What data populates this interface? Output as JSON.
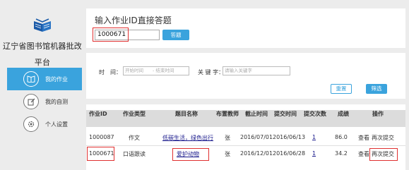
{
  "brand": {
    "line1": "辽宁省图书馆机器批改",
    "line2": "平台"
  },
  "nav": [
    {
      "label": "我的作业",
      "icon": "book-icon",
      "active": true
    },
    {
      "label": "我的自测",
      "icon": "edit-icon",
      "active": false
    },
    {
      "label": "个人设置",
      "icon": "gear-icon",
      "active": false
    }
  ],
  "direct": {
    "title": "输入作业ID直接答题",
    "value": "1000671",
    "button": "答题"
  },
  "filter": {
    "time_label": "时　间：",
    "start_placeholder": "开始时间",
    "end_placeholder": "- 结束时间",
    "keyword_label": "关 键 字：",
    "keyword_placeholder": "请输入关键字",
    "reset": "重置",
    "filter": "筛选"
  },
  "table": {
    "headers": [
      "作业ID",
      "作业类型",
      "题目名称",
      "布置教师",
      "截止时间",
      "提交时间",
      "提交次数",
      "成绩",
      "操作"
    ],
    "rows": [
      {
        "id": "1000087",
        "type": "作文",
        "title": "低碳生活，绿色出行",
        "teacher": "张",
        "deadline": "2016/07/01",
        "submitted": "2016/06/13",
        "count": "1",
        "score": "86.0",
        "view": "查看",
        "resubmit": "再次提交"
      },
      {
        "id": "1000671",
        "type": "口语跟读",
        "title": "爱护动物",
        "teacher": "张",
        "deadline": "2016/12/01",
        "submitted": "2016/06/28",
        "count": "1",
        "score": "34.2",
        "view": "查看",
        "resubmit": "再次提交"
      }
    ]
  },
  "colors": {
    "accent": "#3aa3dd",
    "highlight": "#e03030",
    "link": "#1a1a8c"
  }
}
